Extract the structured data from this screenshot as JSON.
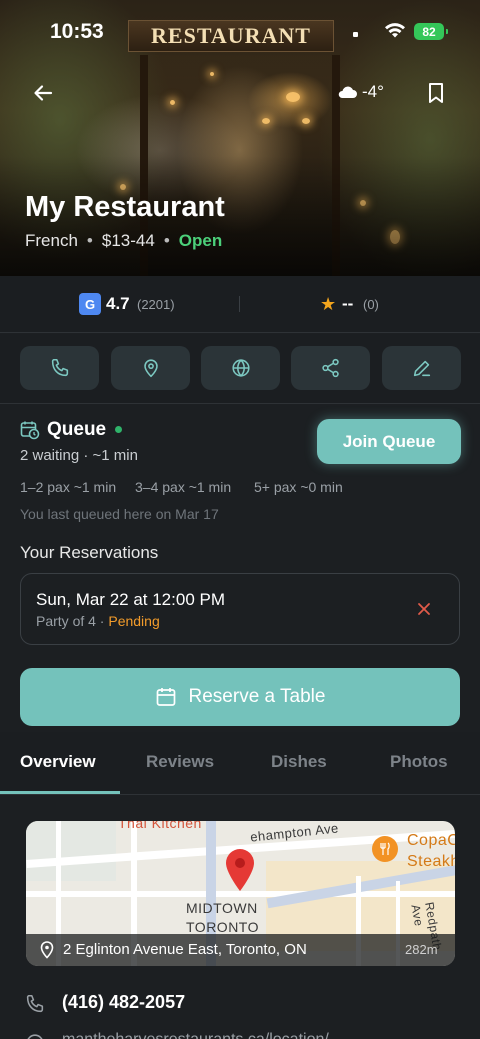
{
  "status_bar": {
    "time": "10:53",
    "battery": "82"
  },
  "hero": {
    "sign_text": "RESTAURANT",
    "weather_temp": "-4°"
  },
  "restaurant": {
    "name": "My Restaurant",
    "cuisine": "French",
    "price": "$13-44",
    "status": "Open"
  },
  "ratings": {
    "google": {
      "badge": "G",
      "score": "4.7",
      "count": "(2201)"
    },
    "app": {
      "score": "--",
      "count": "(0)"
    }
  },
  "actions": [
    "phone-icon",
    "location-pin-icon",
    "globe-icon",
    "share-icon",
    "edit-icon"
  ],
  "queue": {
    "title": "Queue",
    "waiting": "2 waiting · ~1 min",
    "join_label": "Join Queue",
    "pax": [
      "1–2 pax ~1 min",
      "3–4 pax ~1 min",
      "5+ pax ~0 min"
    ],
    "last_queued": "You last queued here on Mar 17"
  },
  "reservations": {
    "heading": "Your Reservations",
    "items": [
      {
        "date": "Sun, Mar 22 at 12:00 PM",
        "party": "Party of 4 · ",
        "status": "Pending"
      }
    ]
  },
  "reserve_button": {
    "label": "Reserve a Table"
  },
  "tabs": [
    "Overview",
    "Reviews",
    "Dishes",
    "Photos"
  ],
  "map": {
    "labels": {
      "thai": "Thai Kitchen",
      "street1": "ehampton Ave",
      "copa1": "CopaC",
      "copa2": "Steakh",
      "midtown": "MIDTOWN",
      "toronto": "TORONTO",
      "redpath": "Redpath Ave"
    },
    "address": "2 Eglinton Avenue East, Toronto, ON",
    "distance": "282m"
  },
  "contact": {
    "phone": "(416) 482-2057",
    "website": "mantheharvesrestaurants.ca/location/..."
  },
  "colors": {
    "accent": "#74c2bb",
    "open": "#4cd07a",
    "pending": "#f39c2b",
    "cancel": "#e05a4a",
    "star": "#f3a51d"
  }
}
